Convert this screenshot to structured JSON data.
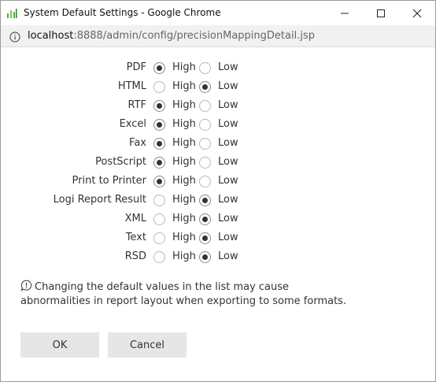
{
  "window": {
    "title": "System Default Settings - Google Chrome",
    "url_host": "localhost",
    "url_path": ":8888/admin/config/precisionMappingDetail.jsp"
  },
  "options": {
    "high": "High",
    "low": "Low"
  },
  "rows": [
    {
      "label": "PDF",
      "selected": "High"
    },
    {
      "label": "HTML",
      "selected": "Low"
    },
    {
      "label": "RTF",
      "selected": "High"
    },
    {
      "label": "Excel",
      "selected": "High"
    },
    {
      "label": "Fax",
      "selected": "High"
    },
    {
      "label": "PostScript",
      "selected": "High"
    },
    {
      "label": "Print to Printer",
      "selected": "High"
    },
    {
      "label": "Logi Report Result",
      "selected": "Low"
    },
    {
      "label": "XML",
      "selected": "Low"
    },
    {
      "label": "Text",
      "selected": "Low"
    },
    {
      "label": "RSD",
      "selected": "Low"
    }
  ],
  "note": "Changing the default values in the list may cause abnormalities in report layout when exporting to some formats.",
  "buttons": {
    "ok": "OK",
    "cancel": "Cancel"
  }
}
